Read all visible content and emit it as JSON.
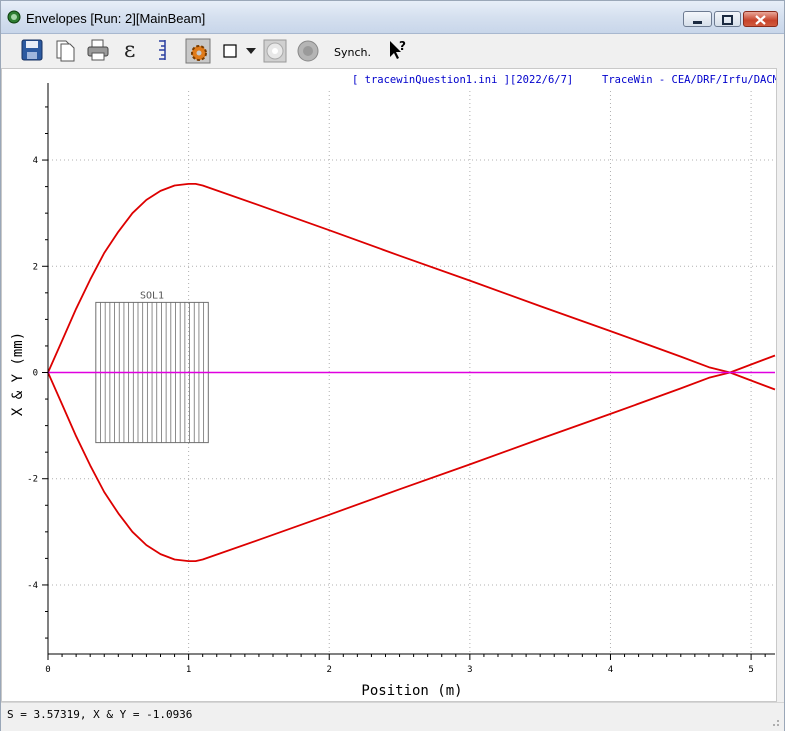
{
  "window": {
    "title": "Envelopes [Run: 2][MainBeam]"
  },
  "toolbar": {
    "icons": [
      "save-icon",
      "copy-icon",
      "print-icon",
      "epsilon-icon",
      "axis-icon",
      "settings-icon",
      "square-icon",
      "dropdown-icon",
      "circle-dim-icon",
      "circle-icon",
      "help-cursor-icon"
    ],
    "synch_label": "Synch.",
    "epsilon_glyph": "ε"
  },
  "header": {
    "file_info": "[ tracewinQuestion1.ini ][2022/6/7]",
    "brand": "TraceWin - CEA/DRF/Irfu/DACM"
  },
  "status": {
    "text": "S = 3.57319, X & Y = -1.0936"
  },
  "colors": {
    "envelope": "#dd0000",
    "centroid": "#e000e0",
    "element": "#707070",
    "header_text": "#0000cc"
  },
  "chart_data": {
    "type": "line",
    "xlabel": "Position (m)",
    "ylabel": "X & Y (mm)",
    "xlim": [
      0,
      5.17
    ],
    "ylim": [
      -5.3,
      5.3
    ],
    "xticks": [
      0,
      1,
      2,
      3,
      4,
      5
    ],
    "yticks": [
      -4,
      -2,
      0,
      2,
      4
    ],
    "grid": true,
    "series": [
      {
        "x": [
          0,
          0.1,
          0.2,
          0.3,
          0.4,
          0.5,
          0.6,
          0.7,
          0.8,
          0.9,
          1.0,
          1.05,
          1.1,
          1.5,
          2.0,
          2.5,
          3.0,
          3.5,
          4.0,
          4.5,
          4.7,
          4.85,
          5.0,
          5.17
        ],
        "y": [
          0,
          0.6,
          1.2,
          1.75,
          2.25,
          2.65,
          3.0,
          3.25,
          3.42,
          3.52,
          3.55,
          3.55,
          3.52,
          3.15,
          2.68,
          2.2,
          1.73,
          1.25,
          0.78,
          0.3,
          0.1,
          0.0,
          0.15,
          0.32
        ]
      },
      {
        "x": [
          0,
          0.1,
          0.2,
          0.3,
          0.4,
          0.5,
          0.6,
          0.7,
          0.8,
          0.9,
          1.0,
          1.05,
          1.1,
          1.5,
          2.0,
          2.5,
          3.0,
          3.5,
          4.0,
          4.5,
          4.7,
          4.85,
          5.0,
          5.17
        ],
        "y": [
          0,
          -0.6,
          -1.2,
          -1.75,
          -2.25,
          -2.65,
          -3.0,
          -3.25,
          -3.42,
          -3.52,
          -3.55,
          -3.55,
          -3.52,
          -3.15,
          -2.68,
          -2.2,
          -1.73,
          -1.25,
          -0.78,
          -0.3,
          -0.1,
          0.0,
          -0.15,
          -0.32
        ]
      },
      {
        "x": [
          0,
          5.17
        ],
        "y": [
          0,
          0
        ]
      }
    ],
    "annotations": [
      {
        "label": "SOL1",
        "x_start": 0.34,
        "x_end": 1.14,
        "y_half_height": 1.32,
        "slices": 24
      }
    ]
  }
}
